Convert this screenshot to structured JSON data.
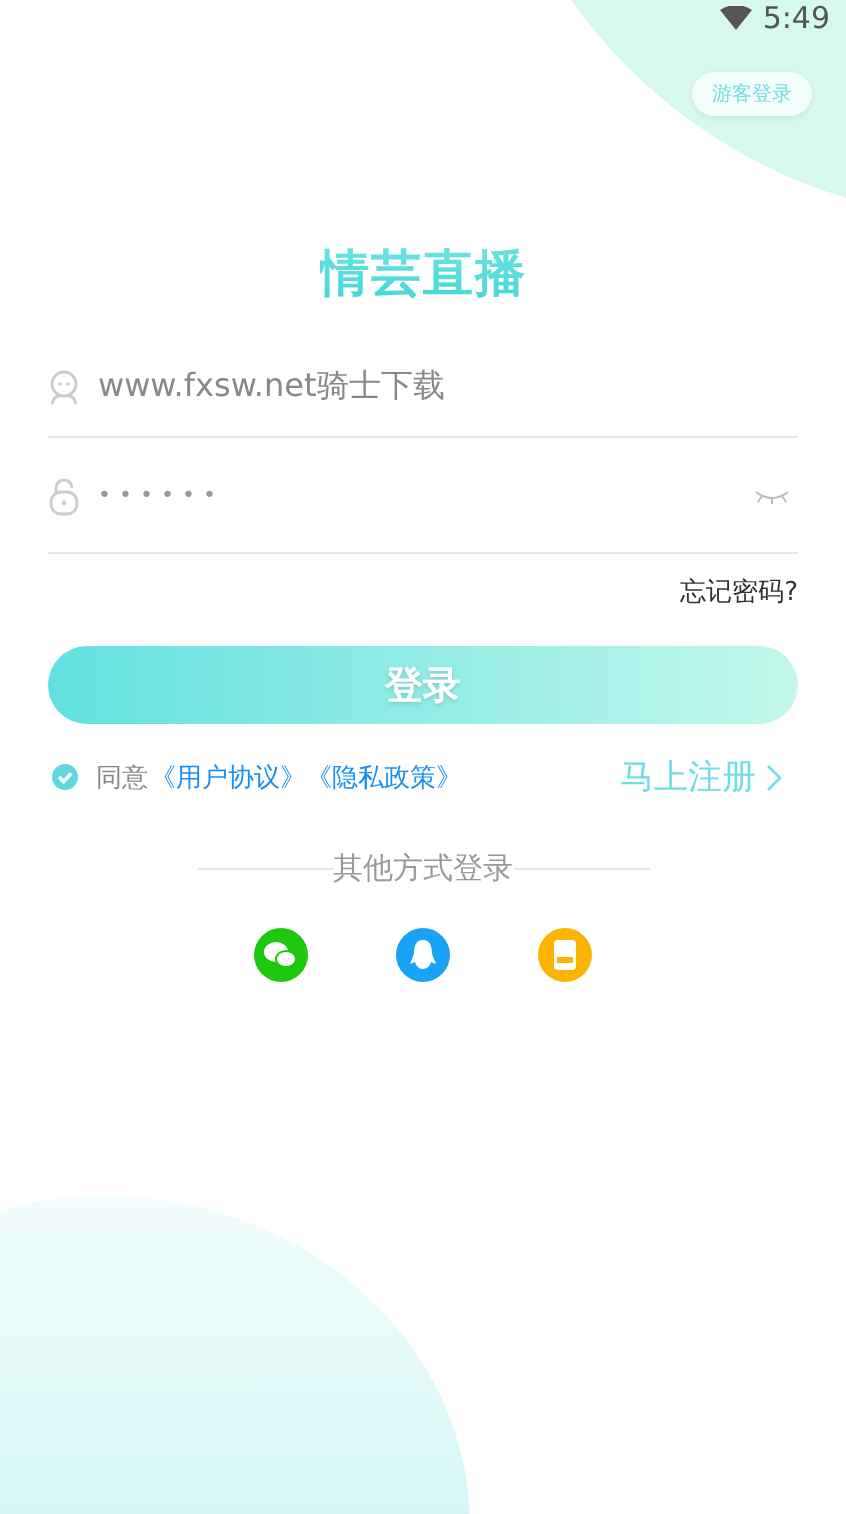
{
  "status_bar": {
    "time": "5:49"
  },
  "guest_button": "游客登录",
  "logo": "情芸直播",
  "username": {
    "value": "www.fxsw.net骑士下载"
  },
  "password": {
    "mask": "••••••"
  },
  "forgot_password": "忘记密码?",
  "login_button": "登录",
  "agreement": {
    "checked": true,
    "prefix": "同意",
    "links": [
      "《用户协议》",
      "《隐私政策》"
    ]
  },
  "register_link": "马上注册",
  "other_login": {
    "label": "其他方式登录",
    "options": [
      {
        "kind": "wechat",
        "color": "#1ec80f"
      },
      {
        "kind": "qq",
        "color": "#1aa3f5"
      },
      {
        "kind": "phone",
        "color": "#fbb400"
      }
    ]
  }
}
